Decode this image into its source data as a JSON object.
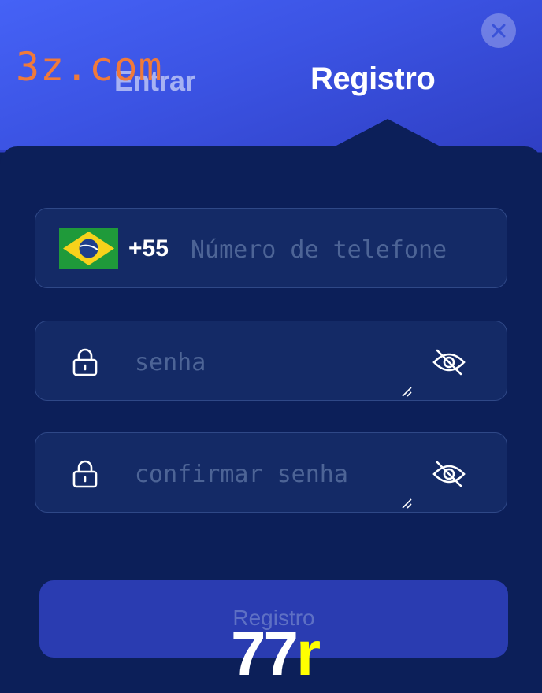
{
  "watermark": "3z.com",
  "tabs": {
    "login": "Entrar",
    "register": "Registro"
  },
  "phone": {
    "country_code": "+55",
    "placeholder": "Número de telefone",
    "flag": "brazil-flag-icon"
  },
  "password": {
    "placeholder": "senha"
  },
  "confirm_password": {
    "placeholder": "confirmar senha"
  },
  "submit": {
    "label": "Registro"
  },
  "badge": {
    "number": "77",
    "letter": "r"
  },
  "icons": {
    "close": "close-icon",
    "lock": "lock-icon",
    "eye_off": "eye-off-icon"
  },
  "colors": {
    "accent": "#3b53e3",
    "panel": "#0c1f59",
    "field": "#142a66",
    "button": "#2a3cb1"
  }
}
